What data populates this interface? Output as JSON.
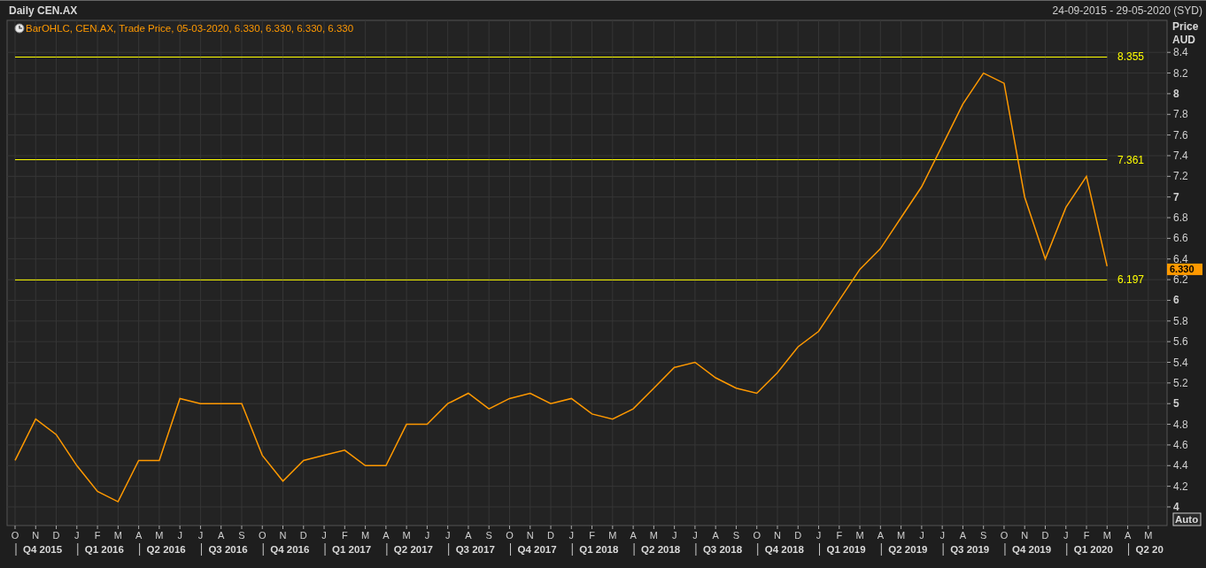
{
  "header": {
    "title": "Daily CEN.AX",
    "range": "24-09-2015 - 29-05-2020 (SYD)"
  },
  "legend": {
    "text": "BarOHLC, CEN.AX, Trade Price, 05-03-2020, 6.330, 6.330, 6.330, 6.330"
  },
  "price_axis": {
    "currency": "AUD",
    "last_price": "6.330",
    "scale_button": "Auto"
  },
  "quarters": [
    "Q4 2015",
    "Q1 2016",
    "Q2 2016",
    "Q3 2016",
    "Q4 2016",
    "Q1 2017",
    "Q2 2017",
    "Q3 2017",
    "Q4 2017",
    "Q1 2018",
    "Q2 2018",
    "Q3 2018",
    "Q4 2018",
    "Q1 2019",
    "Q2 2019",
    "Q3 2019",
    "Q4 2019",
    "Q1 2020",
    "Q2 20"
  ],
  "chart": {
    "chart_data": {
      "type": "line",
      "ylabel": "Price",
      "grid": true,
      "categories": [
        "O",
        "N",
        "D",
        "J",
        "F",
        "M",
        "A",
        "M",
        "J",
        "J",
        "A",
        "S",
        "O",
        "N",
        "D",
        "J",
        "F",
        "M",
        "A",
        "M",
        "J",
        "J",
        "A",
        "S",
        "O",
        "N",
        "D",
        "J",
        "F",
        "M",
        "A",
        "M",
        "J",
        "J",
        "A",
        "S",
        "O",
        "N",
        "D",
        "J",
        "F",
        "M",
        "A",
        "M",
        "J",
        "J",
        "A",
        "S",
        "O",
        "N",
        "D",
        "J",
        "F",
        "M",
        "A",
        "M"
      ],
      "series": [
        {
          "name": "8.355",
          "color": "#ffff00",
          "values": [
            8.355,
            8.355,
            8.355,
            8.355,
            8.355,
            8.355,
            8.355,
            8.355,
            8.355,
            8.355,
            8.355,
            8.355,
            8.355,
            8.355,
            8.355,
            8.355,
            8.355,
            8.355,
            8.355,
            8.355,
            8.355,
            8.355,
            8.355,
            8.355,
            8.355,
            8.355,
            8.355,
            8.355,
            8.355,
            8.355,
            8.355,
            8.355,
            8.355,
            8.355,
            8.355,
            8.355,
            8.355,
            8.355,
            8.355,
            8.355,
            8.355,
            8.355,
            8.355,
            8.355,
            8.355,
            8.355,
            8.355,
            8.355,
            8.355,
            8.355,
            8.355,
            8.355,
            8.355,
            8.355,
            null,
            null
          ]
        },
        {
          "name": "7.361",
          "color": "#ffff00",
          "values": [
            7.361,
            7.361,
            7.361,
            7.361,
            7.361,
            7.361,
            7.361,
            7.361,
            7.361,
            7.361,
            7.361,
            7.361,
            7.361,
            7.361,
            7.361,
            7.361,
            7.361,
            7.361,
            7.361,
            7.361,
            7.361,
            7.361,
            7.361,
            7.361,
            7.361,
            7.361,
            7.361,
            7.361,
            7.361,
            7.361,
            7.361,
            7.361,
            7.361,
            7.361,
            7.361,
            7.361,
            7.361,
            7.361,
            7.361,
            7.361,
            7.361,
            7.361,
            7.361,
            7.361,
            7.361,
            7.361,
            7.361,
            7.361,
            7.361,
            7.361,
            7.361,
            7.361,
            7.361,
            7.361,
            null,
            null
          ]
        },
        {
          "name": "6.197",
          "color": "#ffff00",
          "values": [
            6.197,
            6.197,
            6.197,
            6.197,
            6.197,
            6.197,
            6.197,
            6.197,
            6.197,
            6.197,
            6.197,
            6.197,
            6.197,
            6.197,
            6.197,
            6.197,
            6.197,
            6.197,
            6.197,
            6.197,
            6.197,
            6.197,
            6.197,
            6.197,
            6.197,
            6.197,
            6.197,
            6.197,
            6.197,
            6.197,
            6.197,
            6.197,
            6.197,
            6.197,
            6.197,
            6.197,
            6.197,
            6.197,
            6.197,
            6.197,
            6.197,
            6.197,
            6.197,
            6.197,
            6.197,
            6.197,
            6.197,
            6.197,
            6.197,
            6.197,
            6.197,
            6.197,
            6.197,
            6.197,
            null,
            null
          ]
        },
        {
          "color": "#ff9900",
          "values": [
            4.45,
            4.85,
            4.7,
            4.4,
            4.15,
            4.05,
            4.45,
            4.45,
            5.05,
            5.0,
            5.0,
            5.0,
            4.5,
            4.25,
            4.45,
            4.5,
            4.55,
            4.4,
            4.4,
            4.8,
            4.8,
            5.0,
            5.1,
            4.95,
            5.05,
            5.1,
            5.0,
            5.05,
            4.9,
            4.85,
            4.95,
            5.15,
            5.35,
            5.4,
            5.25,
            5.15,
            5.1,
            5.3,
            5.55,
            5.7,
            6.0,
            6.3,
            6.5,
            6.8,
            7.1,
            7.5,
            7.9,
            8.2,
            8.1,
            7.0,
            6.4,
            6.9,
            7.2,
            6.33,
            null,
            null
          ]
        }
      ],
      "ylim": [
        3.82,
        8.71
      ],
      "yticks": [
        4,
        4.2,
        4.4,
        4.6,
        4.8,
        5,
        5.2,
        5.4,
        5.6,
        5.8,
        6,
        6.2,
        6.4,
        6.6,
        6.8,
        7,
        7.2,
        7.4,
        7.6,
        7.8,
        8,
        8.2,
        8.4
      ]
    }
  }
}
